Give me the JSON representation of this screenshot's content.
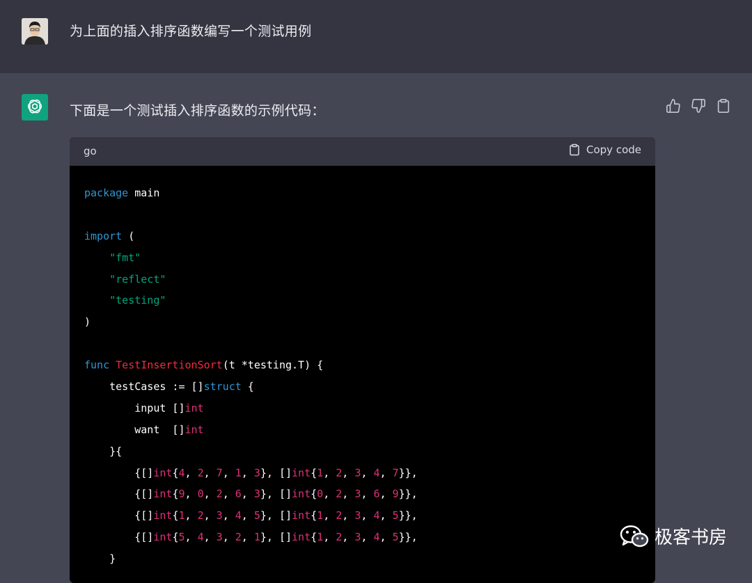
{
  "user": {
    "message": "为上面的插入排序函数编写一个测试用例"
  },
  "assistant": {
    "intro": "下面是一个测试插入排序函数的示例代码：",
    "feedback_icons": [
      "thumbs-up-icon",
      "thumbs-down-icon",
      "clipboard-icon"
    ]
  },
  "code": {
    "language": "go",
    "copy_label": "Copy code",
    "lines": [
      [
        [
          "kw",
          "package"
        ],
        [
          "p",
          " main"
        ]
      ],
      [],
      [
        [
          "kw",
          "import"
        ],
        [
          "p",
          " ("
        ]
      ],
      [
        [
          "p",
          "    "
        ],
        [
          "str",
          "\"fmt\""
        ]
      ],
      [
        [
          "p",
          "    "
        ],
        [
          "str",
          "\"reflect\""
        ]
      ],
      [
        [
          "p",
          "    "
        ],
        [
          "str",
          "\"testing\""
        ]
      ],
      [
        [
          "p",
          ")"
        ]
      ],
      [],
      [
        [
          "kw",
          "func"
        ],
        [
          "p",
          " "
        ],
        [
          "fn",
          "TestInsertionSort"
        ],
        [
          "p",
          "(t *testing.T) {"
        ]
      ],
      [
        [
          "p",
          "    testCases := []"
        ],
        [
          "kw",
          "struct"
        ],
        [
          "p",
          " {"
        ]
      ],
      [
        [
          "p",
          "        input []"
        ],
        [
          "ty",
          "int"
        ]
      ],
      [
        [
          "p",
          "        want  []"
        ],
        [
          "ty",
          "int"
        ]
      ],
      [
        [
          "p",
          "    }{"
        ]
      ],
      [
        [
          "p",
          "        {[]"
        ],
        [
          "ty",
          "int"
        ],
        [
          "p",
          "{"
        ],
        [
          "num",
          "4"
        ],
        [
          "p",
          ", "
        ],
        [
          "num",
          "2"
        ],
        [
          "p",
          ", "
        ],
        [
          "num",
          "7"
        ],
        [
          "p",
          ", "
        ],
        [
          "num",
          "1"
        ],
        [
          "p",
          ", "
        ],
        [
          "num",
          "3"
        ],
        [
          "p",
          "}, []"
        ],
        [
          "ty",
          "int"
        ],
        [
          "p",
          "{"
        ],
        [
          "num",
          "1"
        ],
        [
          "p",
          ", "
        ],
        [
          "num",
          "2"
        ],
        [
          "p",
          ", "
        ],
        [
          "num",
          "3"
        ],
        [
          "p",
          ", "
        ],
        [
          "num",
          "4"
        ],
        [
          "p",
          ", "
        ],
        [
          "num",
          "7"
        ],
        [
          "p",
          "}},"
        ]
      ],
      [
        [
          "p",
          "        {[]"
        ],
        [
          "ty",
          "int"
        ],
        [
          "p",
          "{"
        ],
        [
          "num",
          "9"
        ],
        [
          "p",
          ", "
        ],
        [
          "num",
          "0"
        ],
        [
          "p",
          ", "
        ],
        [
          "num",
          "2"
        ],
        [
          "p",
          ", "
        ],
        [
          "num",
          "6"
        ],
        [
          "p",
          ", "
        ],
        [
          "num",
          "3"
        ],
        [
          "p",
          "}, []"
        ],
        [
          "ty",
          "int"
        ],
        [
          "p",
          "{"
        ],
        [
          "num",
          "0"
        ],
        [
          "p",
          ", "
        ],
        [
          "num",
          "2"
        ],
        [
          "p",
          ", "
        ],
        [
          "num",
          "3"
        ],
        [
          "p",
          ", "
        ],
        [
          "num",
          "6"
        ],
        [
          "p",
          ", "
        ],
        [
          "num",
          "9"
        ],
        [
          "p",
          "}},"
        ]
      ],
      [
        [
          "p",
          "        {[]"
        ],
        [
          "ty",
          "int"
        ],
        [
          "p",
          "{"
        ],
        [
          "num",
          "1"
        ],
        [
          "p",
          ", "
        ],
        [
          "num",
          "2"
        ],
        [
          "p",
          ", "
        ],
        [
          "num",
          "3"
        ],
        [
          "p",
          ", "
        ],
        [
          "num",
          "4"
        ],
        [
          "p",
          ", "
        ],
        [
          "num",
          "5"
        ],
        [
          "p",
          "}, []"
        ],
        [
          "ty",
          "int"
        ],
        [
          "p",
          "{"
        ],
        [
          "num",
          "1"
        ],
        [
          "p",
          ", "
        ],
        [
          "num",
          "2"
        ],
        [
          "p",
          ", "
        ],
        [
          "num",
          "3"
        ],
        [
          "p",
          ", "
        ],
        [
          "num",
          "4"
        ],
        [
          "p",
          ", "
        ],
        [
          "num",
          "5"
        ],
        [
          "p",
          "}},"
        ]
      ],
      [
        [
          "p",
          "        {[]"
        ],
        [
          "ty",
          "int"
        ],
        [
          "p",
          "{"
        ],
        [
          "num",
          "5"
        ],
        [
          "p",
          ", "
        ],
        [
          "num",
          "4"
        ],
        [
          "p",
          ", "
        ],
        [
          "num",
          "3"
        ],
        [
          "p",
          ", "
        ],
        [
          "num",
          "2"
        ],
        [
          "p",
          ", "
        ],
        [
          "num",
          "1"
        ],
        [
          "p",
          "}, []"
        ],
        [
          "ty",
          "int"
        ],
        [
          "p",
          "{"
        ],
        [
          "num",
          "1"
        ],
        [
          "p",
          ", "
        ],
        [
          "num",
          "2"
        ],
        [
          "p",
          ", "
        ],
        [
          "num",
          "3"
        ],
        [
          "p",
          ", "
        ],
        [
          "num",
          "4"
        ],
        [
          "p",
          ", "
        ],
        [
          "num",
          "5"
        ],
        [
          "p",
          "}},"
        ]
      ],
      [
        [
          "p",
          "    }"
        ]
      ]
    ]
  },
  "watermark": {
    "text": "极客书房"
  },
  "colors": {
    "user_bg": "#343541",
    "assistant_bg": "#444654",
    "brand_green": "#10a37f",
    "keyword": "#2e95d3",
    "string": "#00a67d",
    "function": "#f22c3d",
    "type_number": "#df3079"
  }
}
